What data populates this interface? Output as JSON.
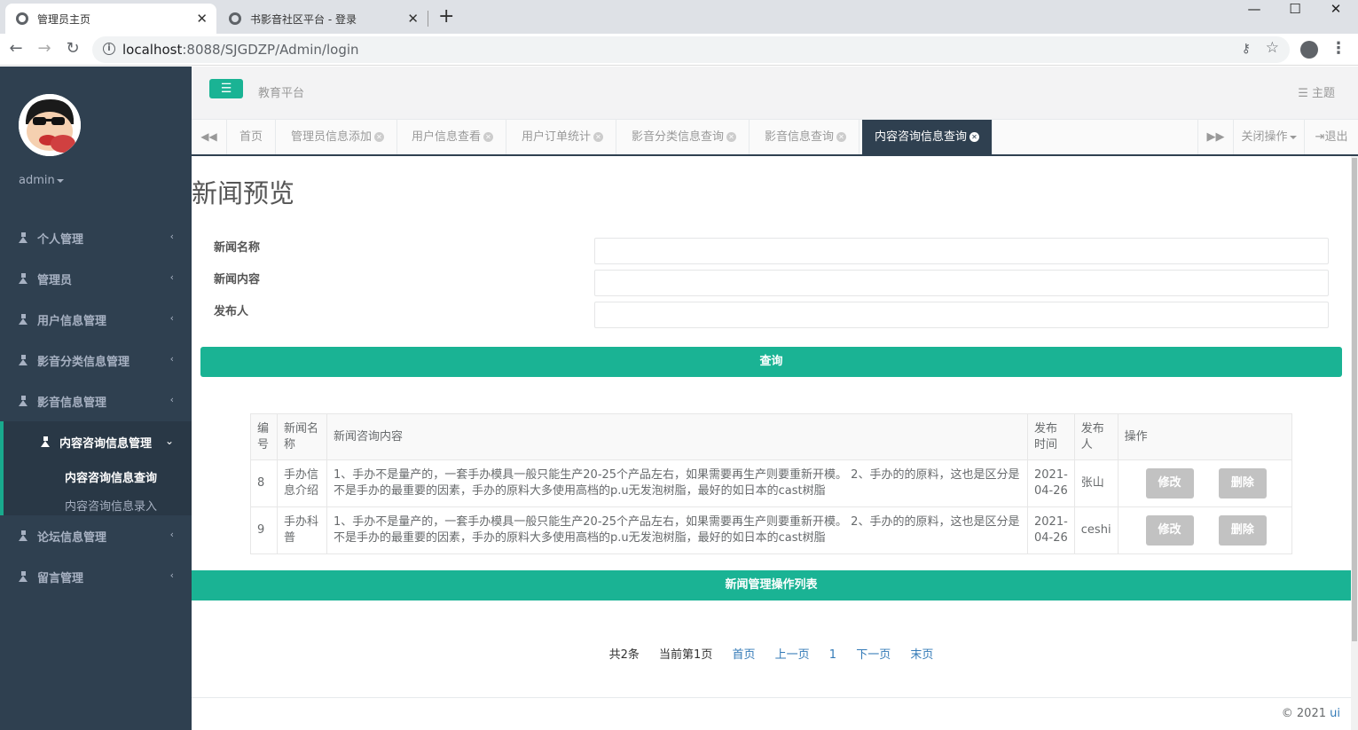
{
  "browser": {
    "tabs": [
      {
        "title": "管理员主页",
        "close": "✕"
      },
      {
        "title": "书影音社区平台 - 登录",
        "close": "✕"
      }
    ],
    "new_tab": "+",
    "window_controls": [
      "—",
      "☐",
      "✕"
    ],
    "url_host": "localhost",
    "url_path": ":8088/SJGDZP/Admin/login"
  },
  "sidebar": {
    "username": "admin",
    "menu": [
      {
        "label": "个人管理"
      },
      {
        "label": "管理员"
      },
      {
        "label": "用户信息管理"
      },
      {
        "label": "影音分类信息管理"
      },
      {
        "label": "影音信息管理"
      }
    ],
    "active_menu": {
      "label": "内容咨询信息管理",
      "children": [
        "内容咨询信息查询",
        "内容咨询信息录入"
      ]
    },
    "menu_after": [
      {
        "label": "论坛信息管理"
      },
      {
        "label": "留言管理"
      }
    ]
  },
  "header": {
    "brand": "教育平台",
    "theme": "主题"
  },
  "content_tabs": {
    "items": [
      "首页",
      "管理员信息添加",
      "用户信息查看",
      "用户订单统计",
      "影音分类信息查询",
      "影音信息查询",
      "内容咨询信息查询"
    ],
    "close_ops": "关闭操作",
    "logout": "退出"
  },
  "page": {
    "title": "新闻预览",
    "fields": [
      {
        "label": "新闻名称",
        "value": ""
      },
      {
        "label": "新闻内容",
        "value": ""
      },
      {
        "label": "发布人",
        "value": ""
      }
    ],
    "query_button": "查询",
    "table": {
      "headers": [
        "编号",
        "新闻名称",
        "新闻咨询内容",
        "发布时间",
        "发布人",
        "操作"
      ],
      "rows": [
        {
          "id": "8",
          "name": "手办信息介绍",
          "content": "1、手办不是量产的，一套手办模具一般只能生产20-25个产品左右，如果需要再生产则要重新开模。 2、手办的的原料，这也是区分是不是手办的最重要的因素，手办的原料大多使用高档的p.u无发泡树脂，最好的如日本的cast树脂",
          "time": "2021-04-26",
          "author": "张山",
          "edit": "修改",
          "delete": "删除"
        },
        {
          "id": "9",
          "name": "手办科普",
          "content": "1、手办不是量产的，一套手办模具一般只能生产20-25个产品左右，如果需要再生产则要重新开模。 2、手办的的原料，这也是区分是不是手办的最重要的因素，手办的原料大多使用高档的p.u无发泡树脂，最好的如日本的cast树脂",
          "time": "2021-04-26",
          "author": "ceshi",
          "edit": "修改",
          "delete": "删除"
        }
      ]
    },
    "list_bar": "新闻管理操作列表",
    "pager": {
      "total": "共2条",
      "current": "当前第1页",
      "first": "首页",
      "prev": "上一页",
      "page": "1",
      "next": "下一页",
      "last": "末页"
    }
  },
  "footer": {
    "copyright": "© 2021",
    "link": "ui"
  },
  "colors": {
    "sidebar": "#2f4050",
    "accent": "#1ab394",
    "link": "#337ab7"
  }
}
